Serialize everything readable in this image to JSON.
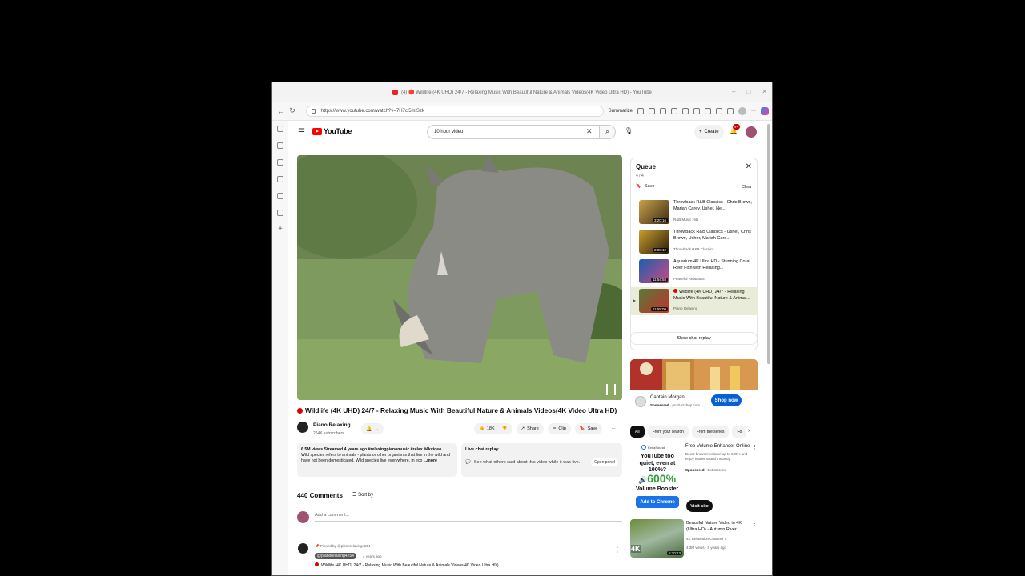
{
  "window": {
    "title": "(4) 🔴 Wildlife (4K UHD) 24/7 - Relaxing Music With Beautiful Nature & Animals Videos(4K Video Ultra HD) - YouTube"
  },
  "browser": {
    "url": "https://www.youtube.com/watch?v=7H7cl5mlSzk",
    "summarize_label": "Summarize"
  },
  "header": {
    "logo_text": "YouTube",
    "search_value": "10 hour video",
    "create_label": "Create",
    "notification_count": "9+"
  },
  "video": {
    "title": "Wildlife (4K UHD) 24/7 - Relaxing Music With Beautiful Nature & Animals Videos(4K Video Ultra HD)",
    "channel": "Piano Relaxing",
    "subscribers": "264K subscribers",
    "likes": "18K",
    "share_label": "Share",
    "clip_label": "Clip",
    "save_label": "Save"
  },
  "description": {
    "meta": "6.5M views  Streamed 4 years ago  #relaxingpianomusic #relax #4kvideo",
    "text": "Wild species refers to animals - plants or other organisms that live in the wild and have not been domesticated. Wild species live everywhere, in eco",
    "more": "...more"
  },
  "live_chat": {
    "title": "Live chat replay",
    "text": "See what others said about this video while it was live.",
    "open_label": "Open panel"
  },
  "comments": {
    "count_label": "440 Comments",
    "sort_label": "Sort by",
    "add_placeholder": "Add a comment...",
    "pinned_by": "Pinned by @pianorelaxing4254",
    "handle": "@pianorelaxing4254",
    "time": "4 years ago",
    "text": "Wildlife (4K UHD) 24/7 - Relaxing Music With Beautiful Nature & Animals Videos(4K Video Ultra HD)"
  },
  "queue": {
    "title": "Queue",
    "position": "4 / 4",
    "save_label": "Save",
    "clear_label": "Clear",
    "items": [
      {
        "title": "Throwback R&B Classics - Chris Brown, Mariah Carey, Usher, Ne...",
        "channel": "R&B Music Hits",
        "duration": "3:20:16"
      },
      {
        "title": "Throwback R&B Classics - Usher, Chris Brown, Usher, Mariah Care...",
        "channel": "Throwback R&B Classics",
        "duration": "2:08:12"
      },
      {
        "title": "Aquarium 4K Ultra HD - Stunning Coral Reef Fish with Relaxing...",
        "channel": "Peaceful Relaxation",
        "duration": "11:54:58"
      },
      {
        "title": "Wildlife (4K UHD) 24/7 - Relaxing Music With Beautiful Nature & Animal...",
        "channel": "Piano Relaxing",
        "duration": "11:55:00"
      }
    ],
    "chat_replay_label": "Show chat replay"
  },
  "ad1": {
    "title": "Captain Morgan",
    "sponsored": "Sponsored",
    "domain": "· productshop.com...",
    "cta": "Shop now"
  },
  "chips": [
    "All",
    "From your search",
    "From the series",
    "Fo"
  ],
  "ad2": {
    "brand": "ExtraSound",
    "headline": "YouTube too quiet, even at 100%?",
    "percent": "600%",
    "product": "Volume Booster",
    "cta": "Add to Chrome",
    "title": "Free Volume Enhancer Online",
    "desc": "Boost browser volume up to 600% and enjoy louder sound instantly",
    "sponsored": "Sponsored",
    "advertiser": "· ExtraSound",
    "visit": "Visit site"
  },
  "rec": {
    "title": "Beautiful Nature Video in 4K (Ultra HD) - Autumn River...",
    "channel": "4K Relaxation Channel",
    "views": "4.3M views · 5 years ago",
    "duration": "5:30:13",
    "badge": "4K"
  },
  "colors": {
    "accent": "#065fd4",
    "brand_red": "#ff0000",
    "active_queue_bg": "#e8ecd8"
  }
}
